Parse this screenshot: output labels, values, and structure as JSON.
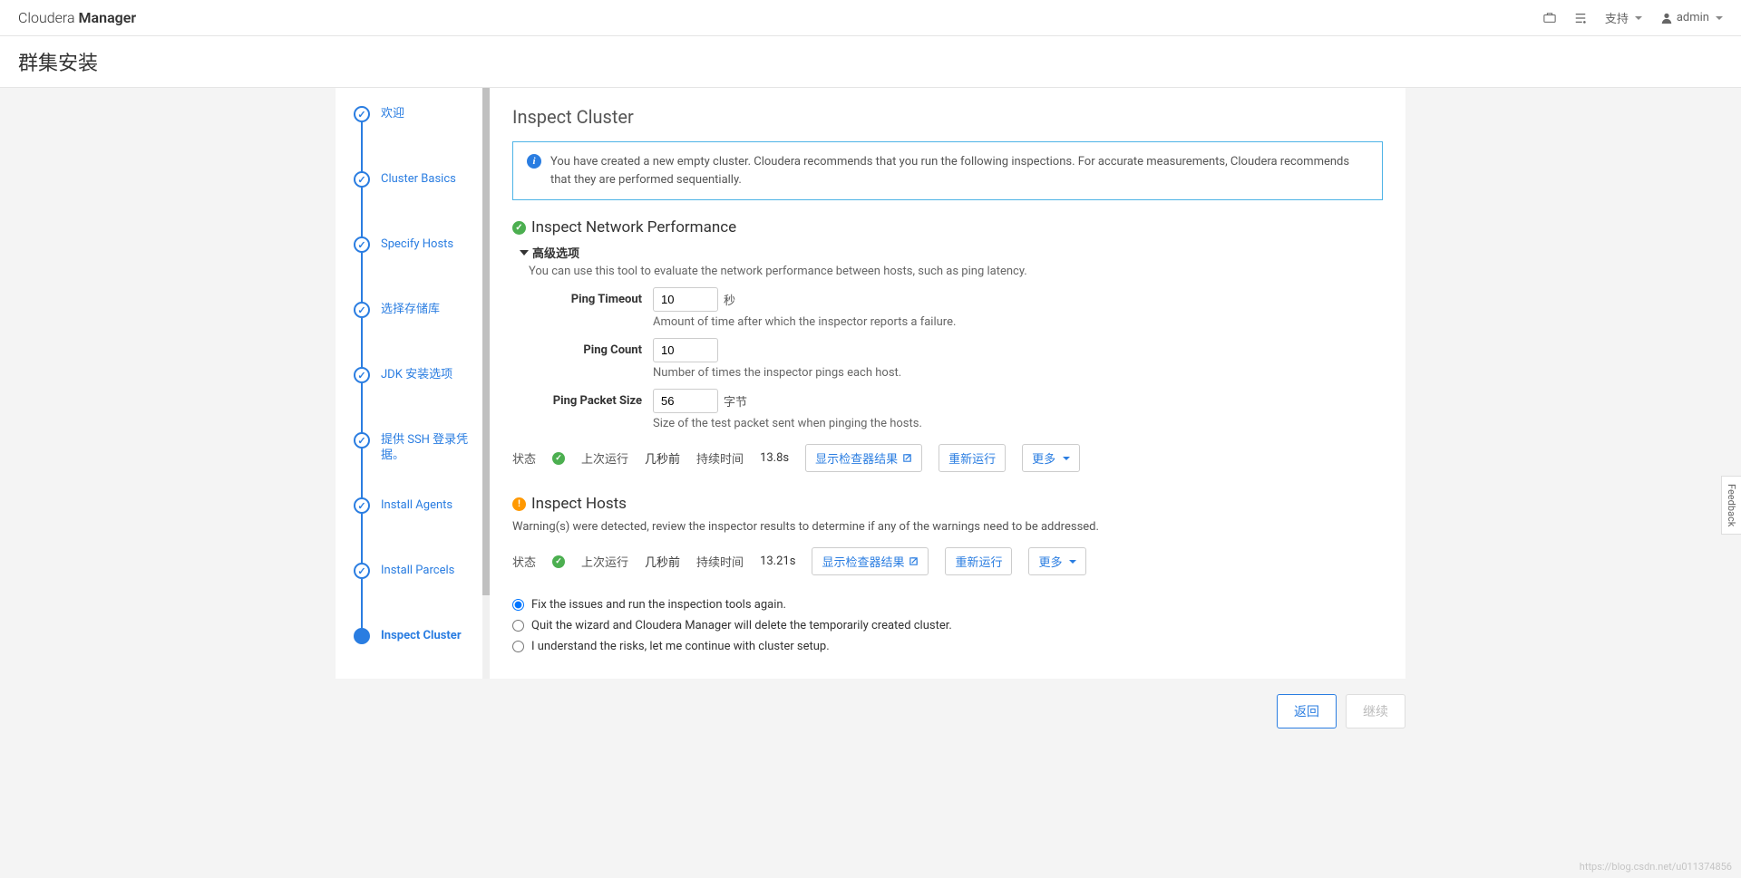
{
  "header": {
    "brand_light": "Cloudera",
    "brand_bold": "Manager",
    "support": "支持",
    "user": "admin"
  },
  "page_title": "群集安装",
  "steps": [
    {
      "label": "欢迎",
      "state": "done"
    },
    {
      "label": "Cluster Basics",
      "state": "done"
    },
    {
      "label": "Specify Hosts",
      "state": "done"
    },
    {
      "label": "选择存储库",
      "state": "done"
    },
    {
      "label": "JDK 安装选项",
      "state": "done"
    },
    {
      "label": "提供 SSH 登录凭据。",
      "state": "done"
    },
    {
      "label": "Install Agents",
      "state": "done"
    },
    {
      "label": "Install Parcels",
      "state": "done"
    },
    {
      "label": "Inspect Cluster",
      "state": "active"
    }
  ],
  "main": {
    "title": "Inspect Cluster",
    "info_box": "You have created a new empty cluster. Cloudera recommends that you run the following inspections. For accurate measurements, Cloudera recommends that they are performed sequentially.",
    "network": {
      "title": "Inspect Network Performance",
      "advanced": "高级选项",
      "help": "You can use this tool to evaluate the network performance between hosts, such as ping latency.",
      "fields": {
        "timeout_label": "Ping Timeout",
        "timeout_value": "10",
        "timeout_unit": "秒",
        "timeout_help": "Amount of time after which the inspector reports a failure.",
        "count_label": "Ping Count",
        "count_value": "10",
        "count_help": "Number of times the inspector pings each host.",
        "packet_label": "Ping Packet Size",
        "packet_value": "56",
        "packet_unit": "字节",
        "packet_help": "Size of the test packet sent when pinging the hosts."
      },
      "status": {
        "state_label": "状态",
        "last_run_label": "上次运行",
        "last_run_value": "几秒前",
        "duration_label": "持续时间",
        "duration_value": "13.8s",
        "show_results": "显示检查器结果",
        "rerun": "重新运行",
        "more": "更多"
      }
    },
    "hosts": {
      "title": "Inspect Hosts",
      "warning": "Warning(s) were detected, review the inspector results to determine if any of the warnings need to be addressed.",
      "status": {
        "state_label": "状态",
        "last_run_label": "上次运行",
        "last_run_value": "几秒前",
        "duration_label": "持续时间",
        "duration_value": "13.21s",
        "show_results": "显示检查器结果",
        "rerun": "重新运行",
        "more": "更多"
      }
    },
    "radios": {
      "opt1": "Fix the issues and run the inspection tools again.",
      "opt2": "Quit the wizard and Cloudera Manager will delete the temporarily created cluster.",
      "opt3": "I understand the risks, let me continue with cluster setup."
    }
  },
  "footer": {
    "back": "返回",
    "continue": "继续"
  },
  "feedback": "Feedback",
  "watermark": "https://blog.csdn.net/u011374856"
}
